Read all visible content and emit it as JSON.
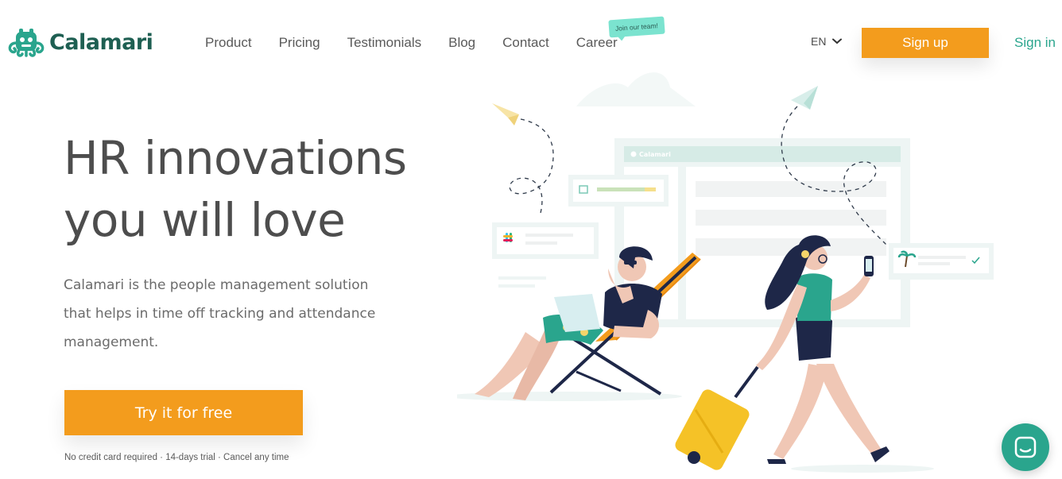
{
  "brand": {
    "name": "Calamari"
  },
  "nav": {
    "items": [
      "Product",
      "Pricing",
      "Testimonials",
      "Blog",
      "Contact",
      "Career"
    ],
    "career_badge": "Join our team!"
  },
  "header": {
    "language": "EN",
    "signup_label": "Sign up",
    "signin_label": "Sign in"
  },
  "hero": {
    "title_line1": "HR innovations",
    "title_line2": "you will love",
    "description": "Calamari is the people management solution that helps in time off tracking and attendance management.",
    "cta_label": "Try it for free",
    "cta_note": "No credit card required · 14-days trial · Cancel any time"
  },
  "illustration": {
    "window_brand": "Calamari"
  },
  "colors": {
    "accent": "#f39c1d",
    "brand": "#2aa58d",
    "logo": "#1e5f52"
  },
  "icons": [
    "calamari-logo-icon",
    "chevron-down-icon",
    "chat-icon",
    "slack-icon",
    "palm-tree-icon",
    "check-icon",
    "paper-plane-icon"
  ]
}
